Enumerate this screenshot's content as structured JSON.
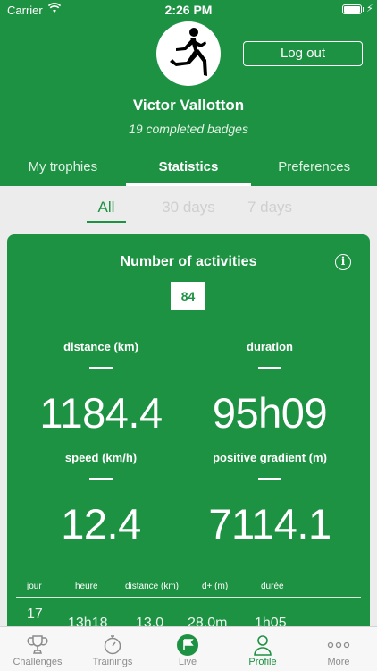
{
  "status_bar": {
    "carrier": "Carrier",
    "time": "2:26 PM"
  },
  "profile": {
    "logout_label": "Log out",
    "name": "Victor Vallotton",
    "badges": "19 completed badges"
  },
  "tabs": [
    {
      "label": "My trophies",
      "active": false
    },
    {
      "label": "Statistics",
      "active": true
    },
    {
      "label": "Preferences",
      "active": false
    }
  ],
  "filters": [
    {
      "label": "All",
      "active": true
    },
    {
      "label": "30 days",
      "active": false
    },
    {
      "label": "7 days",
      "active": false
    }
  ],
  "stats": {
    "title": "Number of activities",
    "count": "84",
    "distance": {
      "label": "distance (km)",
      "value": "1184.4"
    },
    "duration": {
      "label": "duration",
      "value": "95h09"
    },
    "speed": {
      "label": "speed (km/h)",
      "value": "12.4"
    },
    "gradient": {
      "label": "positive gradient (m)",
      "value": "7114.1"
    }
  },
  "table": {
    "headers": [
      "jour",
      "heure",
      "distance (km)",
      "d+ (m)",
      "durée"
    ],
    "rows": [
      [
        "17",
        "13h18",
        "13.0",
        "28.0m",
        "1h05"
      ]
    ]
  },
  "tabbar": [
    {
      "label": "Challenges",
      "icon": "trophy-icon",
      "active": false
    },
    {
      "label": "Trainings",
      "icon": "stopwatch-icon",
      "active": false
    },
    {
      "label": "Live",
      "icon": "flag-icon",
      "active": false
    },
    {
      "label": "Profile",
      "icon": "user-icon",
      "active": true
    },
    {
      "label": "More",
      "icon": "more-dots-icon",
      "active": false
    }
  ],
  "colors": {
    "brand_green": "#1e9243",
    "background": "#ececec",
    "inactive_gray": "#8c8c8c"
  }
}
